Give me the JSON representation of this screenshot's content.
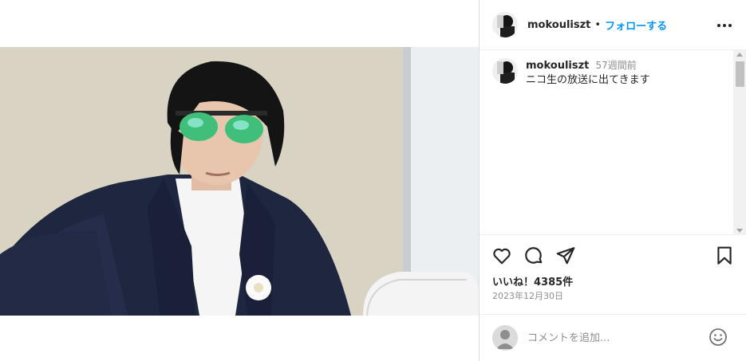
{
  "post": {
    "username": "mokouliszt",
    "follow_label": "フォローする",
    "separator": "•",
    "caption_text": "ニコ生の放送に出てきます",
    "caption_time": "57週間前",
    "likes_text": "いいね！4385件",
    "date_text": "2023年12月30日"
  },
  "comment_box": {
    "placeholder": "コメントを追加..."
  },
  "icons": {
    "more": "more-horizontal-icon",
    "like": "heart-icon",
    "comment": "comment-bubble-icon",
    "share": "send-paper-plane-icon",
    "save": "bookmark-icon",
    "emoji": "emoji-smile-icon"
  },
  "colors": {
    "follow_blue": "#0095f6",
    "text": "#262626",
    "muted": "#8e8e8e",
    "border": "#dbdbdb"
  }
}
